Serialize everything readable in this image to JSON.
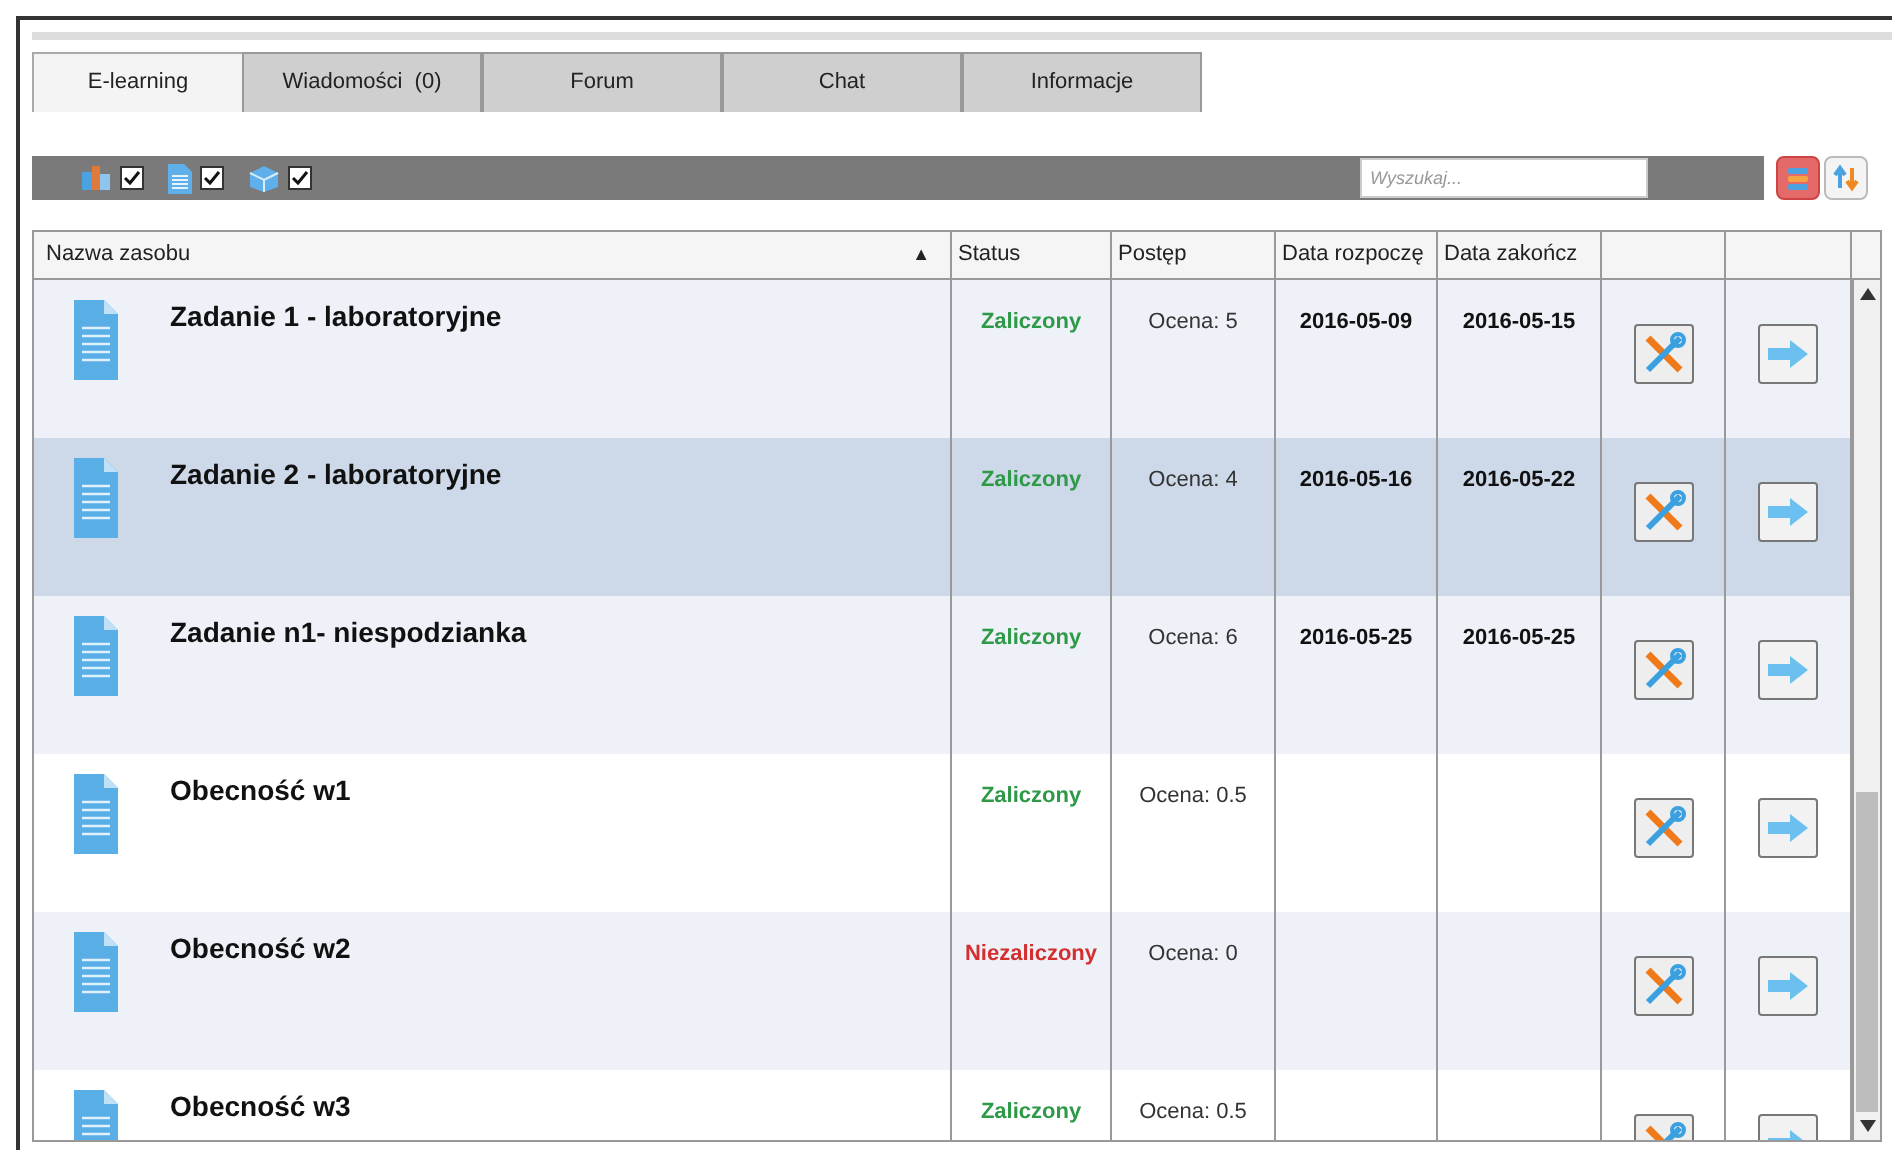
{
  "tabs": [
    {
      "label": "E-learning",
      "selected": true
    },
    {
      "label": "Wiadomości  (0)",
      "selected": false
    },
    {
      "label": "Forum",
      "selected": false
    },
    {
      "label": "Chat",
      "selected": false
    },
    {
      "label": "Informacje",
      "selected": false
    }
  ],
  "toolbar": {
    "filters": [
      {
        "checked": true
      },
      {
        "checked": true
      },
      {
        "checked": true
      }
    ],
    "search": {
      "placeholder": "Wyszukaj..."
    }
  },
  "table": {
    "columns": [
      "Nazwa zasobu",
      "Status",
      "Postęp",
      "Data rozpoczę",
      "Data zakończ"
    ],
    "sort_indicator": "▲",
    "rows": [
      {
        "name": "Zadanie 1 - laboratoryjne",
        "status": "Zaliczony",
        "passed": true,
        "progress": "Ocena: 5",
        "start": "2016-05-09",
        "end": "2016-05-15",
        "selected": false
      },
      {
        "name": "Zadanie 2 - laboratoryjne",
        "status": "Zaliczony",
        "passed": true,
        "progress": "Ocena: 4",
        "start": "2016-05-16",
        "end": "2016-05-22",
        "selected": true
      },
      {
        "name": "Zadanie n1- niespodzianka",
        "status": "Zaliczony",
        "passed": true,
        "progress": "Ocena: 6",
        "start": "2016-05-25",
        "end": "2016-05-25",
        "selected": false
      },
      {
        "name": "Obecność w1",
        "status": "Zaliczony",
        "passed": true,
        "progress": "Ocena: 0.5",
        "selected": false
      },
      {
        "name": "Obecność w2",
        "status": "Niezaliczony",
        "passed": false,
        "progress": "Ocena: 0",
        "selected": false
      },
      {
        "name": "Obecność w3",
        "status": "Zaliczony",
        "passed": true,
        "progress": "Ocena: 0.5",
        "selected": false
      }
    ]
  }
}
